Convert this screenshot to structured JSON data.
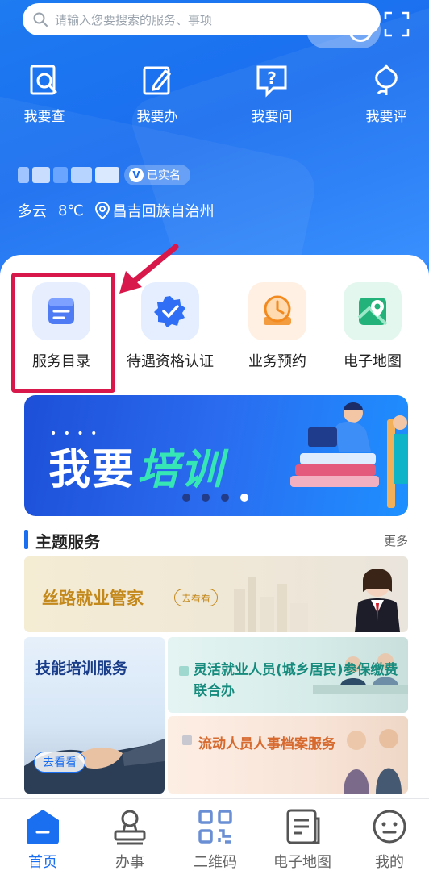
{
  "search": {
    "placeholder": "请输入您要搜索的服务、事项"
  },
  "quick_actions": [
    {
      "label": "我要查",
      "icon": "search-doc-icon"
    },
    {
      "label": "我要办",
      "icon": "edit-doc-icon"
    },
    {
      "label": "我要问",
      "icon": "question-icon"
    },
    {
      "label": "我要评",
      "icon": "flower-icon"
    }
  ],
  "user": {
    "verified_label": "已实名",
    "verified_mark": "V"
  },
  "weather": {
    "condition": "多云",
    "temperature": "8℃",
    "location": "昌吉回族自治州"
  },
  "services": [
    {
      "label": "服务目录",
      "icon": "catalog-icon"
    },
    {
      "label": "待遇资格认证",
      "icon": "certify-icon"
    },
    {
      "label": "业务预约",
      "icon": "clock-icon"
    },
    {
      "label": "电子地图",
      "icon": "map-icon"
    }
  ],
  "banner": {
    "title_white": "我要",
    "title_green": "培训",
    "dots_text": "• • • •",
    "slide_count": 4,
    "active_index": 3
  },
  "theme_section": {
    "title": "主题服务",
    "more": "更多"
  },
  "theme_cards": {
    "silk_road": {
      "title": "丝路就业管家",
      "button": "去看看"
    },
    "skill_training": {
      "title": "技能培训服务",
      "button": "去看看"
    },
    "flexible": {
      "title": "灵活就业人员(城乡居民)参保缴费联合办"
    },
    "floating": {
      "title": "流动人员人事档案服务"
    }
  },
  "tabbar": [
    {
      "label": "首页",
      "icon": "home-icon",
      "active": true
    },
    {
      "label": "办事",
      "icon": "stamp-icon",
      "active": false
    },
    {
      "label": "二维码",
      "icon": "qrcode-icon",
      "active": false
    },
    {
      "label": "电子地图",
      "icon": "document-map-icon",
      "active": false
    },
    {
      "label": "我的",
      "icon": "smile-icon",
      "active": false
    }
  ],
  "colors": {
    "primary": "#1a6ef0",
    "highlight": "#d8174a",
    "banner_green": "#37e6b5"
  }
}
